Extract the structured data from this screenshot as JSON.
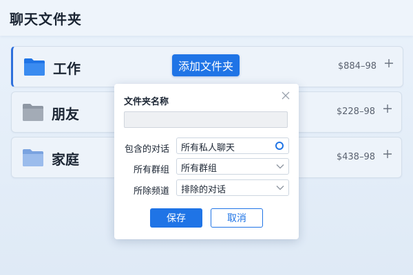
{
  "header": {
    "title": "聊天文件夹"
  },
  "folders": [
    {
      "name": "工作",
      "price": "$884–98",
      "icon": "folder-icon",
      "color": "#1f74e6",
      "active": true
    },
    {
      "name": "朋友",
      "price": "$228–98",
      "icon": "folder-icon",
      "color": "#a3abb6",
      "active": false
    },
    {
      "name": "家庭",
      "price": "$438–98",
      "icon": "folder-icon",
      "color": "#8fb3e8",
      "active": false
    }
  ],
  "add_folder_label": "添加文件夹",
  "dialog": {
    "title": "文件夹名称",
    "name_value": "",
    "name_placeholder": "",
    "fields": [
      {
        "label": "包含的对话",
        "value": "所有私人聊天",
        "control": "radio"
      },
      {
        "label": "所有群组",
        "value": "所有群组",
        "control": "dropdown"
      },
      {
        "label": "所除频道",
        "value": "排除的对话",
        "control": "dropdown"
      }
    ],
    "save_label": "保存",
    "cancel_label": "取消"
  },
  "colors": {
    "accent": "#1f74e6",
    "background": "#e4edf8"
  }
}
